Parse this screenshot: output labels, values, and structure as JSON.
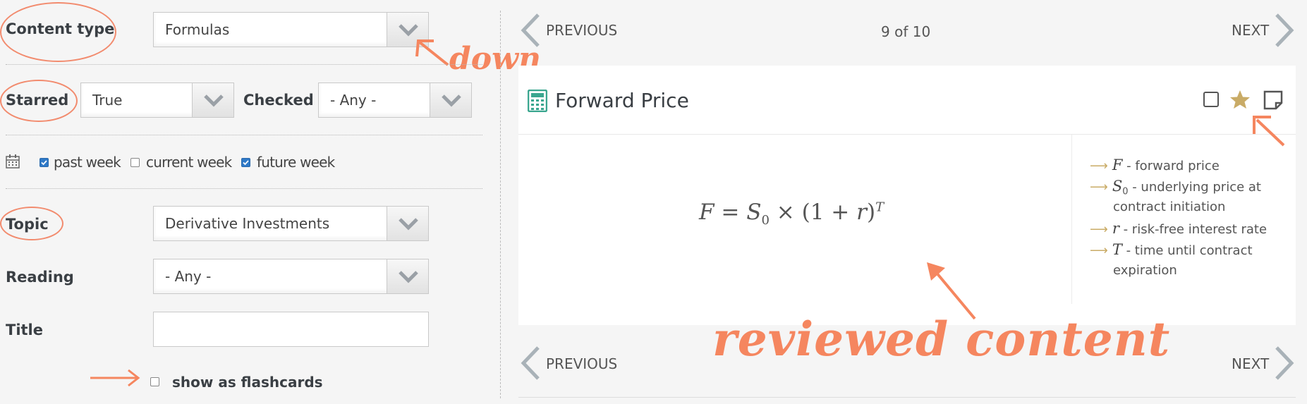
{
  "filters": {
    "content_type": {
      "label": "Content type",
      "value": "Formulas"
    },
    "starred": {
      "label": "Starred",
      "value": "True"
    },
    "checked": {
      "label": "Checked",
      "value": "- Any -"
    },
    "weeks": [
      {
        "label": "past week",
        "checked": true
      },
      {
        "label": "current week",
        "checked": false
      },
      {
        "label": "future week",
        "checked": true
      }
    ],
    "topic": {
      "label": "Topic",
      "value": "Derivative Investments"
    },
    "reading": {
      "label": "Reading",
      "value": "- Any -"
    },
    "title": {
      "label": "Title",
      "value": ""
    },
    "flashcards": {
      "label": "show as flashcards",
      "checked": false
    }
  },
  "pager": {
    "previous": "PREVIOUS",
    "next": "NEXT",
    "position": "9 of 10"
  },
  "card": {
    "title": "Forward Price",
    "formula": {
      "lhs": "F",
      "eq": "=",
      "s": "S",
      "s_sub": "0",
      "times": "×",
      "paren_open": "(1 + ",
      "r": "r",
      "paren_close": ")",
      "exp": "T"
    },
    "legend": [
      {
        "sym": "F",
        "sub": "",
        "text": "- forward price"
      },
      {
        "sym": "S",
        "sub": "0",
        "text": "- underlying price at",
        "cont": "contract initiation"
      },
      {
        "sym": "r",
        "sub": "",
        "text": "- risk-free interest rate"
      },
      {
        "sym": "T",
        "sub": "",
        "text": "- time until contract",
        "cont": "expiration"
      }
    ]
  },
  "annotations": {
    "down": "down",
    "reviewed": "reviewed content"
  },
  "colors": {
    "annotation": "#f5865f",
    "star": "#c9ab66",
    "calculator": "#3aa68f",
    "checkbox": "#2f79c7"
  },
  "icons": [
    "chevron-down-icon",
    "calendar-icon",
    "calculator-icon",
    "chevron-left-icon",
    "chevron-right-icon",
    "checkbox-icon",
    "star-icon",
    "note-icon",
    "arrow-icon"
  ]
}
